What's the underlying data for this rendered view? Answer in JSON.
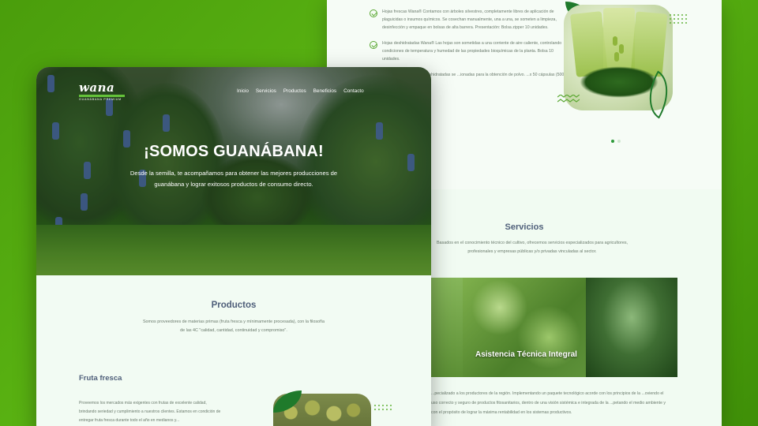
{
  "back_page": {
    "check_items": [
      "Hojas frescas Wana® Contamos con árboles silvestres, completamente libres de aplicación de plaguicidas o insumos químicos. Se cosechan manualmente, una a una, se someten a limpieza, desinfección y empaque en bolsas de alta barrera. Presentación: Bolsa zipper 10 unidades.",
      "Hojas deshidratadas Wana® Las hojas son sometidas a una corriente de aire caliente, controlando condiciones de temperatura y humedad de las propiedades bioquímicas de la planta. Bolsa 10 unidades.",
      "...na Wana® Las hojas deshidratadas se ...ionadas para la obtención de polvo. ...x 50 cápsulas (500 mg)."
    ],
    "services": {
      "title": "Servicios",
      "description": "Basados en el conocimiento técnico del cultivo, ofrecemos servicios especializados para agricultores, profesionales y empresas públicas y/o privadas vinculadas al sector.",
      "image_caption": "Asistencia Técnica Integral",
      "body": "...pecializado a los productores de la región. Implementando un paquete tecnológico acorde con los principios de la ...oviendo el uso correcto y seguro de productos fitosanitarios, dentro de una visión sistémica e integrada de la ...petando el medio ambiente y con el propósito de lograr la máxima rentabilidad en los sistemas productivos."
    }
  },
  "front_page": {
    "logo": {
      "word": "wana",
      "tagline": "GUANÁBANA PREMIUM"
    },
    "nav": [
      "Inicio",
      "Servicios",
      "Productos",
      "Beneficios",
      "Contacto"
    ],
    "hero": {
      "title": "¡SOMOS GUANÁBANA!",
      "subtitle": "Desde la semilla, te acompañamos para obtener las mejores producciones de guanábana y lograr exitosos productos de consumo directo."
    },
    "products": {
      "title": "Productos",
      "description": "Somos proveedores de materias primas (fruta fresca y mínimamente procesada), con la filosofía de las 4C \"calidad, cantidad, continuidad y compromiso\"."
    },
    "fresh_fruit": {
      "title": "Fruta fresca",
      "description": "Proveemos los mercados más exigentes con frutas de excelente calidad, brindando seriedad y cumplimiento a nuestros clientes. Estamos en condición de entregar fruta fresca durante todo el año en medianos y..."
    }
  },
  "colors": {
    "background_green": "#5cb613",
    "heading_blue_gray": "#4f5f7a",
    "accent_green": "#5aa832",
    "leaf_dark_green": "#1f7a2b"
  }
}
